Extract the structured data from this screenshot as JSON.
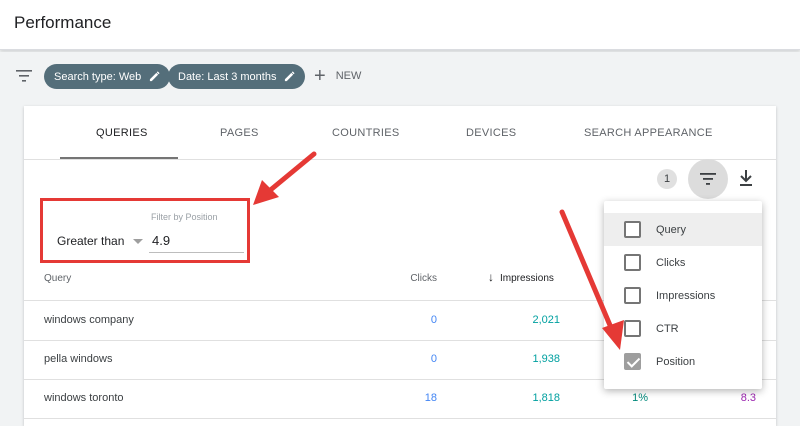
{
  "header": {
    "title": "Performance"
  },
  "filters": {
    "chips": [
      {
        "label": "Search type: Web"
      },
      {
        "label": "Date: Last 3 months"
      }
    ],
    "new_label": "NEW"
  },
  "tabs": [
    {
      "label": "QUERIES",
      "active": true
    },
    {
      "label": "PAGES"
    },
    {
      "label": "COUNTRIES"
    },
    {
      "label": "DEVICES"
    },
    {
      "label": "SEARCH APPEARANCE"
    }
  ],
  "toolbar": {
    "filter_count": "1"
  },
  "position_filter": {
    "label": "Filter by Position",
    "operator": "Greater than",
    "value": "4.9"
  },
  "table": {
    "columns": {
      "query": "Query",
      "clicks": "Clicks",
      "impressions": "Impressions"
    },
    "rows": [
      {
        "query": "windows company",
        "clicks": "0",
        "impressions": "2,021",
        "ctr": "",
        "position": ""
      },
      {
        "query": "pella windows",
        "clicks": "0",
        "impressions": "1,938",
        "ctr": "",
        "position": ""
      },
      {
        "query": "windows toronto",
        "clicks": "18",
        "impressions": "1,818",
        "ctr": "1%",
        "position": "8.3"
      }
    ]
  },
  "filter_menu": {
    "items": [
      {
        "label": "Query",
        "checked": false
      },
      {
        "label": "Clicks",
        "checked": false
      },
      {
        "label": "Impressions",
        "checked": false
      },
      {
        "label": "CTR",
        "checked": false
      },
      {
        "label": "Position",
        "checked": true
      }
    ]
  },
  "colors": {
    "chip_bg": "#546e7a",
    "annotation_red": "#e53935",
    "clicks_blue": "#4285f4",
    "impressions_teal": "#00a0a0",
    "position_purple": "#9c27b0"
  }
}
